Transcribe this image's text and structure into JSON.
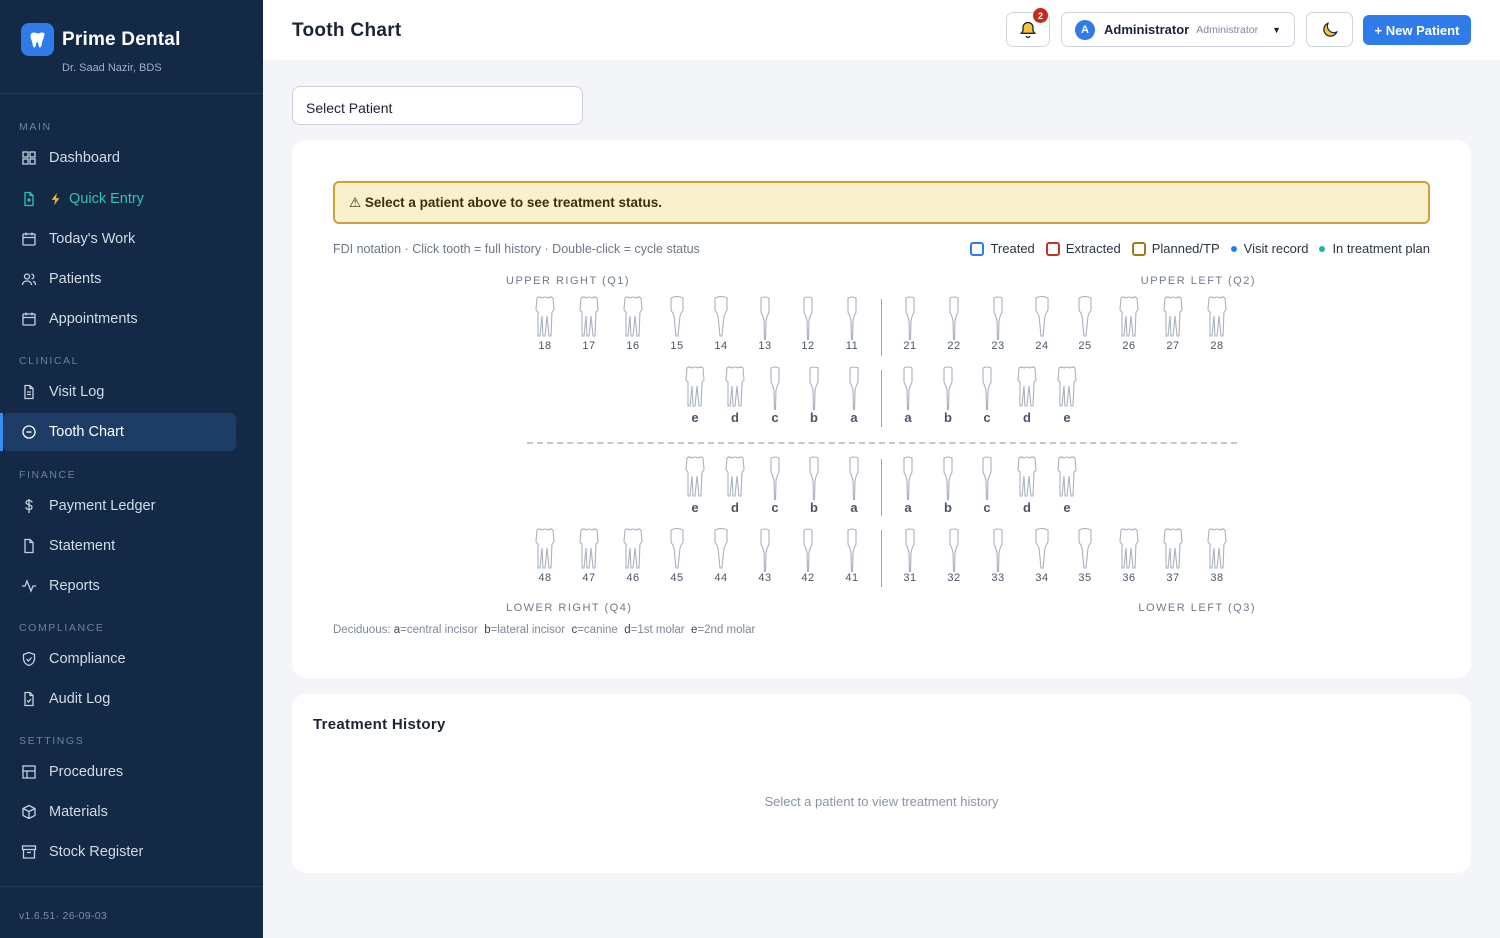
{
  "brand": {
    "name": "Prime Dental",
    "doctor": "Dr. Saad Nazir, BDS"
  },
  "sidebar": {
    "sections": {
      "main": "MAIN",
      "clinical": "CLINICAL",
      "finance": "FINANCE",
      "compliance": "COMPLIANCE",
      "settings": "SETTINGS"
    },
    "items": {
      "dashboard": "Dashboard",
      "quick_entry": "Quick Entry",
      "todays_work": "Today's Work",
      "patients": "Patients",
      "appointments": "Appointments",
      "visit_log": "Visit Log",
      "tooth_chart": "Tooth Chart",
      "payment_ledger": "Payment Ledger",
      "statement": "Statement",
      "reports": "Reports",
      "compliance": "Compliance",
      "audit_log": "Audit Log",
      "procedures": "Procedures",
      "materials": "Materials",
      "stock_register": "Stock Register"
    },
    "version": "v1.6.51· 26-09-03"
  },
  "header": {
    "title": "Tooth Chart",
    "notification_count": "2",
    "user_initial": "A",
    "user_name": "Administrator",
    "user_role": "Administrator",
    "new_patient": "+ New Patient"
  },
  "patient_select": {
    "label": "Select Patient"
  },
  "chart": {
    "warning": "⚠ Select a patient above to see treatment status.",
    "note": "FDI notation · Click tooth = full history · Double-click = cycle status",
    "legend": {
      "treated": "Treated",
      "extracted": "Extracted",
      "planned": "Planned/TP",
      "visit_record": "Visit record",
      "in_plan": "In treatment plan"
    },
    "legend_colors": {
      "treated": "#2f7bea",
      "extracted": "#c0342a",
      "planned": "#a07a1a",
      "visit_record": "#2f7bea",
      "in_plan": "#1fb5a3"
    },
    "quadrants": {
      "q1": "UPPER RIGHT (Q1)",
      "q2": "UPPER LEFT (Q2)",
      "q3": "LOWER LEFT (Q3)",
      "q4": "LOWER RIGHT (Q4)"
    },
    "permanent_upper_right": [
      "18",
      "17",
      "16",
      "15",
      "14",
      "13",
      "12",
      "11"
    ],
    "permanent_upper_left": [
      "21",
      "22",
      "23",
      "24",
      "25",
      "26",
      "27",
      "28"
    ],
    "permanent_lower_right": [
      "48",
      "47",
      "46",
      "45",
      "44",
      "43",
      "42",
      "41"
    ],
    "permanent_lower_left": [
      "31",
      "32",
      "33",
      "34",
      "35",
      "36",
      "37",
      "38"
    ],
    "deciduous_right": [
      "e",
      "d",
      "c",
      "b",
      "a"
    ],
    "deciduous_left": [
      "a",
      "b",
      "c",
      "d",
      "e"
    ],
    "deciduous_note": {
      "k_a": "a",
      "v_a": "=central incisor",
      "k_b": "b",
      "v_b": "=lateral incisor",
      "k_c": "c",
      "v_c": "=canine",
      "k_d": "d",
      "v_d": "=1st molar",
      "k_e": "e",
      "v_e": "=2nd molar"
    }
  },
  "history": {
    "title": "Treatment History",
    "empty": "Select a patient to view treatment history"
  }
}
